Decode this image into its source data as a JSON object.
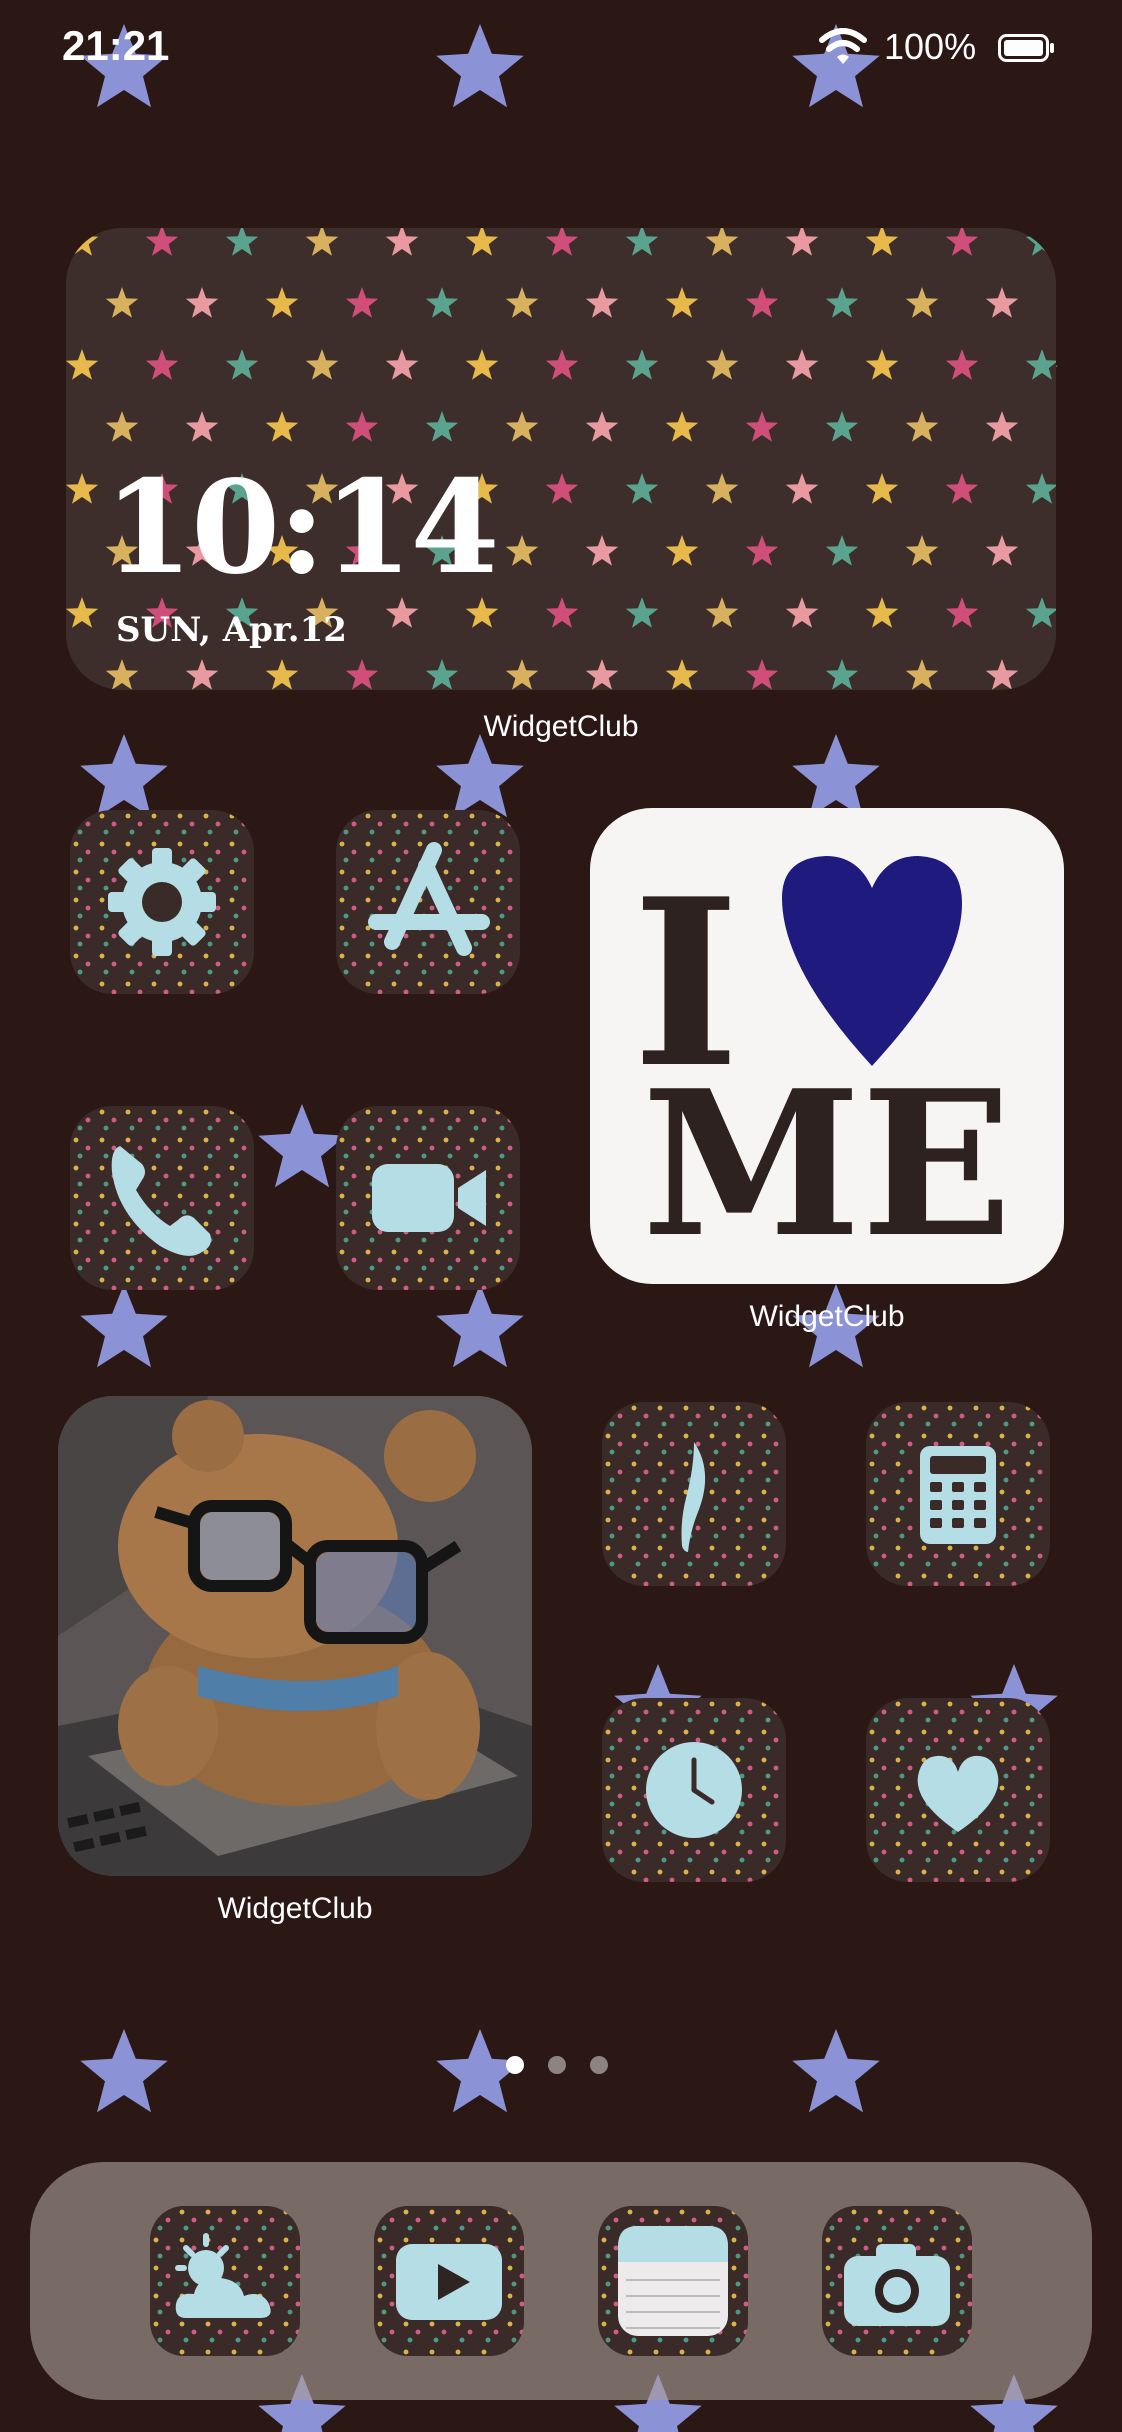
{
  "status_bar": {
    "time": "21:21",
    "battery_percent": "100%",
    "battery_level": 1.0,
    "wifi_icon": "wifi-icon",
    "battery_icon": "battery-icon"
  },
  "widgets": {
    "clock": {
      "time": "10:14",
      "date": "SUN, Apr.12",
      "label": "WidgetClub"
    },
    "love_me": {
      "top_letter": "I",
      "bottom_text": "ME",
      "heart_color": "#1e1a7e",
      "label": "WidgetClub"
    },
    "photo": {
      "subject": "teddy-bear-with-glasses-photo",
      "label": "WidgetClub"
    }
  },
  "apps": [
    {
      "icon": "settings-icon"
    },
    {
      "icon": "app-store-icon"
    },
    {
      "icon": "phone-icon"
    },
    {
      "icon": "facetime-icon"
    },
    {
      "icon": "feather-icon"
    },
    {
      "icon": "calculator-icon"
    },
    {
      "icon": "clock-icon"
    },
    {
      "icon": "heart-icon"
    }
  ],
  "pages": {
    "count": 3,
    "active": 1
  },
  "dock": [
    {
      "icon": "weather-icon"
    },
    {
      "icon": "youtube-icon"
    },
    {
      "icon": "notes-icon"
    },
    {
      "icon": "camera-icon"
    }
  ],
  "colors": {
    "background": "#2b1814",
    "background_star": "#8c92d6",
    "icon_glyph": "#b5dde6",
    "icon_bg": "#3b2b28"
  }
}
